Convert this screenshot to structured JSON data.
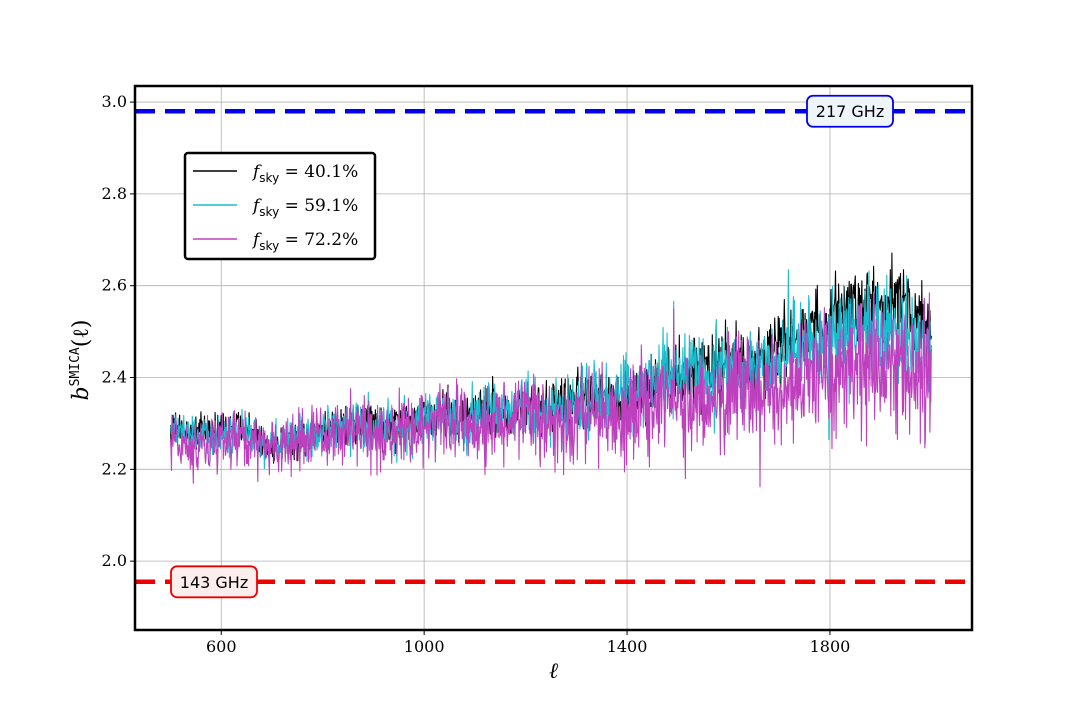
{
  "chart_data": {
    "type": "line",
    "xlabel": "ℓ",
    "ylabel_main": "b",
    "ylabel_sup": "SMICA",
    "ylabel_tail": "(ℓ)",
    "xlim": [
      430,
      2080
    ],
    "ylim": [
      1.85,
      3.035
    ],
    "xticks": [
      600,
      1000,
      1400,
      1800
    ],
    "yticks": [
      2.0,
      2.2,
      2.4,
      2.6,
      2.8,
      3.0
    ],
    "xtick_labels": [
      "600",
      "1000",
      "1400",
      "1800"
    ],
    "ytick_labels": [
      "2.0",
      "2.2",
      "2.4",
      "2.6",
      "2.8",
      "3.0"
    ],
    "grid": true,
    "legend_position": "upper-left",
    "reference_lines": [
      {
        "label": "217 GHz",
        "y": 2.98,
        "color": "#0000ee",
        "style": "dashed",
        "label_position": "right"
      },
      {
        "label": "143 GHz",
        "y": 1.955,
        "color": "#ee0000",
        "style": "dashed",
        "label_position": "left"
      }
    ],
    "x_start": 500,
    "x_end": 2000,
    "series": [
      {
        "name": "f_sky = 40.1%",
        "legend_main": "f",
        "legend_sub": "sky",
        "legend_tail": " = 40.1%",
        "color": "#000000",
        "x": [
          500,
          550,
          600,
          650,
          700,
          750,
          800,
          850,
          900,
          950,
          1000,
          1050,
          1100,
          1150,
          1200,
          1250,
          1300,
          1350,
          1400,
          1450,
          1500,
          1550,
          1600,
          1650,
          1700,
          1750,
          1800,
          1850,
          1900,
          1950,
          2000
        ],
        "y": [
          2.29,
          2.28,
          2.29,
          2.3,
          2.24,
          2.26,
          2.28,
          2.3,
          2.29,
          2.3,
          2.31,
          2.32,
          2.31,
          2.33,
          2.33,
          2.33,
          2.35,
          2.37,
          2.35,
          2.38,
          2.4,
          2.42,
          2.44,
          2.42,
          2.47,
          2.49,
          2.53,
          2.57,
          2.55,
          2.57,
          2.46
        ],
        "noise": 0.05
      },
      {
        "name": "f_sky = 59.1%",
        "legend_main": "f",
        "legend_sub": "sky",
        "legend_tail": " = 59.1%",
        "color": "#17becf",
        "x": [
          500,
          550,
          600,
          650,
          700,
          750,
          800,
          850,
          900,
          950,
          1000,
          1050,
          1100,
          1150,
          1200,
          1250,
          1300,
          1350,
          1400,
          1450,
          1500,
          1550,
          1600,
          1650,
          1700,
          1750,
          1800,
          1850,
          1900,
          1950,
          2000
        ],
        "y": [
          2.28,
          2.27,
          2.27,
          2.28,
          2.25,
          2.27,
          2.28,
          2.3,
          2.28,
          2.29,
          2.31,
          2.32,
          2.31,
          2.33,
          2.33,
          2.32,
          2.34,
          2.36,
          2.36,
          2.39,
          2.41,
          2.41,
          2.42,
          2.42,
          2.44,
          2.47,
          2.48,
          2.5,
          2.49,
          2.5,
          2.45
        ],
        "noise": 0.06
      },
      {
        "name": "f_sky = 72.2%",
        "legend_main": "f",
        "legend_sub": "sky",
        "legend_tail": " = 72.2%",
        "color": "#bf40bf",
        "x": [
          500,
          550,
          600,
          650,
          700,
          750,
          800,
          850,
          900,
          950,
          1000,
          1050,
          1100,
          1150,
          1200,
          1250,
          1300,
          1350,
          1400,
          1450,
          1500,
          1550,
          1600,
          1650,
          1700,
          1750,
          1800,
          1850,
          1900,
          1950,
          2000
        ],
        "y": [
          2.26,
          2.25,
          2.26,
          2.26,
          2.24,
          2.26,
          2.27,
          2.29,
          2.27,
          2.28,
          2.29,
          2.31,
          2.29,
          2.3,
          2.31,
          2.3,
          2.32,
          2.33,
          2.32,
          2.34,
          2.36,
          2.35,
          2.36,
          2.36,
          2.37,
          2.4,
          2.41,
          2.42,
          2.41,
          2.43,
          2.38
        ],
        "noise": 0.08
      }
    ]
  }
}
